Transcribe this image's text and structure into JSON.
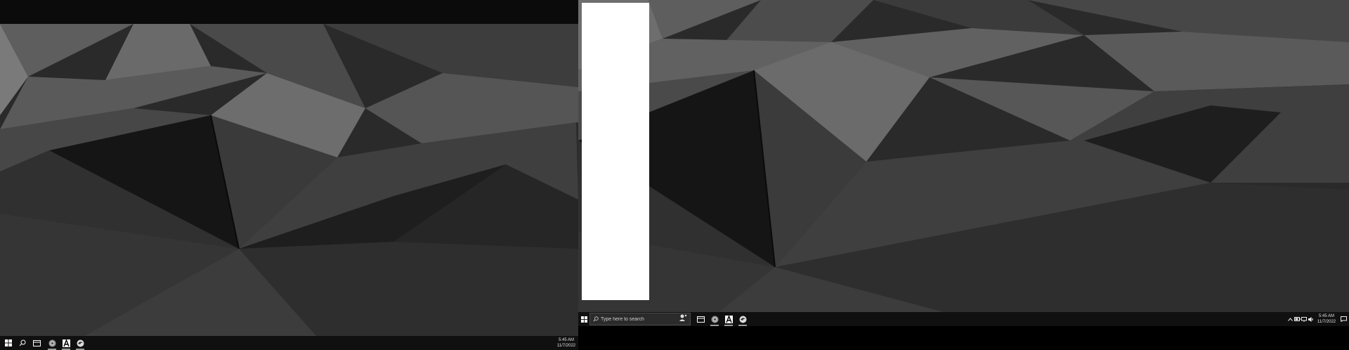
{
  "left_monitor": {
    "taskbar": {
      "icons": [
        "windows-start-icon",
        "search-icon",
        "task-view-icon",
        "chrome-icon",
        "font-a-icon",
        "browser-icon"
      ],
      "clock": {
        "time": "5:45 AM",
        "date": "11/7/2022"
      }
    }
  },
  "right_monitor": {
    "taskbar": {
      "search": {
        "placeholder": "Type here to search"
      },
      "icons": [
        "windows-start-icon",
        "search-icon",
        "assistant-icon",
        "task-view-icon",
        "chrome-icon",
        "font-a-icon",
        "browser-icon"
      ],
      "tray_icons": [
        "chevron-up-icon",
        "battery-icon",
        "network-icon",
        "volume-icon",
        "notification-icon"
      ],
      "clock": {
        "time": "5:45 AM",
        "date": "11/7/2022"
      }
    }
  },
  "colors": {
    "taskbar": "#101010",
    "wallpaper_base": "#2a2a2a",
    "window": "#ffffff"
  }
}
